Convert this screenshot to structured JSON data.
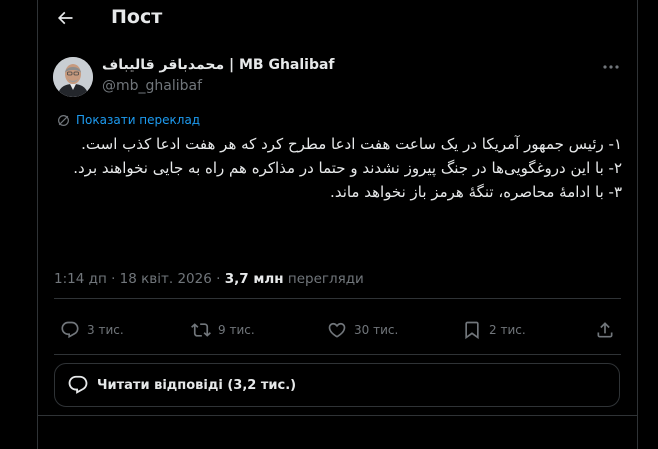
{
  "header": {
    "title": "Пост"
  },
  "author": {
    "name": "محمدباقر قالیباف | MB Ghalibaf",
    "handle": "@mb_ghalibaf"
  },
  "translate_label": "Показати переклад",
  "post": {
    "lines": [
      "۱- رئیس جمهور آمریکا در یک ساعت هفت ادعا مطرح کرد که هر هفت ادعا کذب است.",
      "۲- با این دروغگویی‌ها در جنگ پیروز نشدند و حتما در مذاکره هم راه به جایی نخواهند برد.",
      "۳- با ادامهٔ محاصره، تنگهٔ هرمز باز نخواهد ماند."
    ]
  },
  "meta": {
    "time": "1:14 дп",
    "date": "18 квіт. 2026",
    "views": "3,7 млн",
    "views_label": "перегляди"
  },
  "actions": {
    "replies": "3 тис.",
    "reposts": "9 тис.",
    "likes": "30 тис.",
    "bookmarks": "2 тис."
  },
  "read_replies": "Читати відповіді (3,2 тис.)",
  "icons": {
    "back": "arrow-left-icon",
    "more": "more-icon",
    "translate": "translate-icon",
    "reply": "reply-icon",
    "repost": "repost-icon",
    "like": "heart-icon",
    "bookmark": "bookmark-icon",
    "share": "share-icon"
  },
  "colors": {
    "background": "#000000",
    "text": "#e7e9ea",
    "muted": "#71767b",
    "accent": "#1d9bf0",
    "border": "#2f3336"
  }
}
